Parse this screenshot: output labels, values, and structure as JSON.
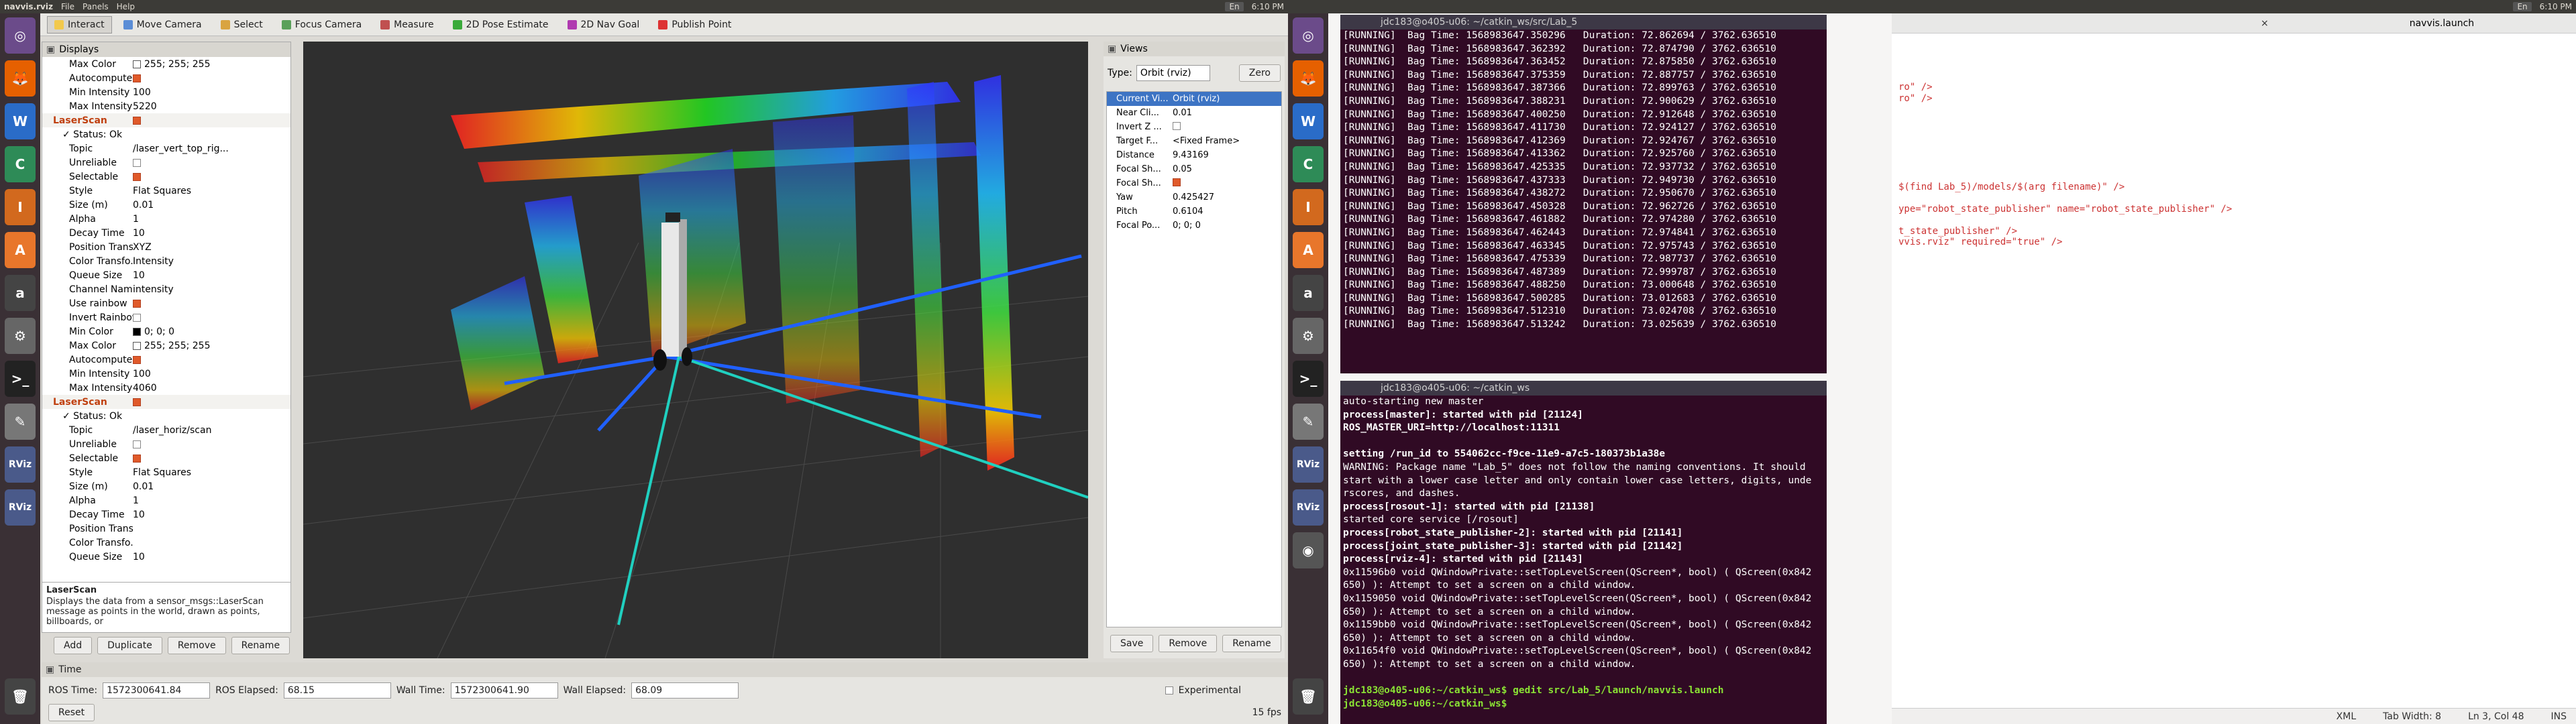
{
  "left": {
    "topbar": {
      "app": "navvis.rviz",
      "menus": [
        "File",
        "Panels",
        "Help"
      ],
      "keyboard": "En",
      "time": "6:10 PM"
    },
    "toolbar": [
      {
        "label": "Interact",
        "color": "#f2c94c"
      },
      {
        "label": "Move Camera",
        "color": "#5b8dd6"
      },
      {
        "label": "Select",
        "color": "#d9a441"
      },
      {
        "label": "Focus Camera",
        "color": "#5aa05a"
      },
      {
        "label": "Measure",
        "color": "#c05050"
      },
      {
        "label": "2D Pose Estimate",
        "color": "#3aaa3a"
      },
      {
        "label": "2D Nav Goal",
        "color": "#b03ab0"
      },
      {
        "label": "Publish Point",
        "color": "#d33"
      }
    ],
    "displays": {
      "title": "Displays",
      "rows": [
        {
          "n": "Max Color",
          "v": "255; 255; 255",
          "sw": "#ffffff"
        },
        {
          "n": "Autocompute ...",
          "cb": true
        },
        {
          "n": "Min Intensity",
          "v": "100"
        },
        {
          "n": "Max Intensity",
          "v": "5220"
        },
        {
          "n": "LaserScan",
          "cb": true,
          "head": true
        },
        {
          "n": "✓ Status: Ok",
          "sub": true
        },
        {
          "n": "Topic",
          "v": "/laser_vert_top_rig..."
        },
        {
          "n": "Unreliable",
          "cb": false
        },
        {
          "n": "Selectable",
          "cb": true
        },
        {
          "n": "Style",
          "v": "Flat Squares"
        },
        {
          "n": "Size (m)",
          "v": "0.01"
        },
        {
          "n": "Alpha",
          "v": "1"
        },
        {
          "n": "Decay Time",
          "v": "10"
        },
        {
          "n": "Position Trans...",
          "v": "XYZ"
        },
        {
          "n": "Color Transfo...",
          "v": "Intensity"
        },
        {
          "n": "Queue Size",
          "v": "10"
        },
        {
          "n": "Channel Name",
          "v": "intensity"
        },
        {
          "n": "Use rainbow",
          "cb": true
        },
        {
          "n": "Invert Rainbow",
          "cb": false
        },
        {
          "n": "Min Color",
          "v": "0; 0; 0",
          "sw": "#000000"
        },
        {
          "n": "Max Color",
          "v": "255; 255; 255",
          "sw": "#ffffff"
        },
        {
          "n": "Autocompute ...",
          "cb": true
        },
        {
          "n": "Min Intensity",
          "v": "100"
        },
        {
          "n": "Max Intensity",
          "v": "4060"
        },
        {
          "n": "LaserScan",
          "cb": true,
          "head": true
        },
        {
          "n": "✓ Status: Ok",
          "sub": true
        },
        {
          "n": "Topic",
          "v": "/laser_horiz/scan"
        },
        {
          "n": "Unreliable",
          "cb": false
        },
        {
          "n": "Selectable",
          "cb": true
        },
        {
          "n": "Style",
          "v": "Flat Squares"
        },
        {
          "n": "Size (m)",
          "v": "0.01"
        },
        {
          "n": "Alpha",
          "v": "1"
        },
        {
          "n": "Decay Time",
          "v": "10"
        },
        {
          "n": "Position Trans...",
          "v": ""
        },
        {
          "n": "Color Transfo...",
          "v": ""
        },
        {
          "n": "Queue Size",
          "v": "10"
        }
      ]
    },
    "help": {
      "title": "LaserScan",
      "text": "Displays the data from a sensor_msgs::LaserScan message as points in the world, drawn as points, billboards, or"
    },
    "display_buttons": [
      "Add",
      "Duplicate",
      "Remove",
      "Rename"
    ],
    "views": {
      "title": "Views",
      "type_label": "Type:",
      "type_value": "Orbit (rviz)",
      "zero": "Zero",
      "current": {
        "n": "Current Vi...",
        "v": "Orbit (rviz)"
      },
      "rows": [
        {
          "n": "Near Cli...",
          "v": "0.01"
        },
        {
          "n": "Invert Z ...",
          "cb": false
        },
        {
          "n": "Target F...",
          "v": "<Fixed Frame>"
        },
        {
          "n": "Distance",
          "v": "9.43169"
        },
        {
          "n": "Focal Sh...",
          "v": "0.05"
        },
        {
          "n": "Focal Sh...",
          "cb": true
        },
        {
          "n": "Yaw",
          "v": "0.425427"
        },
        {
          "n": "Pitch",
          "v": "0.6104"
        },
        {
          "n": "Focal Po...",
          "v": "0; 0; 0"
        }
      ],
      "buttons": [
        "Save",
        "Remove",
        "Rename"
      ]
    },
    "time": {
      "title": "Time",
      "ros_time_label": "ROS Time:",
      "ros_time": "1572300641.84",
      "ros_elapsed_label": "ROS Elapsed:",
      "ros_elapsed": "68.15",
      "wall_time_label": "Wall Time:",
      "wall_time": "1572300641.90",
      "wall_elapsed_label": "Wall Elapsed:",
      "wall_elapsed": "68.09",
      "experimental": "Experimental",
      "reset": "Reset",
      "fps": "15 fps"
    }
  },
  "right": {
    "topbar": {
      "keyboard": "En",
      "time": "6:10 PM"
    },
    "term1": {
      "title": "jdc183@o405-u06: ~/catkin_ws/src/Lab_5",
      "lines": [
        "[RUNNING]  Bag Time: 1568983647.350296   Duration: 72.862694 / 3762.636510",
        "[RUNNING]  Bag Time: 1568983647.362392   Duration: 72.874790 / 3762.636510",
        "[RUNNING]  Bag Time: 1568983647.363452   Duration: 72.875850 / 3762.636510",
        "[RUNNING]  Bag Time: 1568983647.375359   Duration: 72.887757 / 3762.636510",
        "[RUNNING]  Bag Time: 1568983647.387366   Duration: 72.899763 / 3762.636510",
        "[RUNNING]  Bag Time: 1568983647.388231   Duration: 72.900629 / 3762.636510",
        "[RUNNING]  Bag Time: 1568983647.400250   Duration: 72.912648 / 3762.636510",
        "[RUNNING]  Bag Time: 1568983647.411730   Duration: 72.924127 / 3762.636510",
        "[RUNNING]  Bag Time: 1568983647.412369   Duration: 72.924767 / 3762.636510",
        "[RUNNING]  Bag Time: 1568983647.413362   Duration: 72.925760 / 3762.636510",
        "[RUNNING]  Bag Time: 1568983647.425335   Duration: 72.937732 / 3762.636510",
        "[RUNNING]  Bag Time: 1568983647.437333   Duration: 72.949730 / 3762.636510",
        "[RUNNING]  Bag Time: 1568983647.438272   Duration: 72.950670 / 3762.636510",
        "[RUNNING]  Bag Time: 1568983647.450328   Duration: 72.962726 / 3762.636510",
        "[RUNNING]  Bag Time: 1568983647.461882   Duration: 72.974280 / 3762.636510",
        "[RUNNING]  Bag Time: 1568983647.462443   Duration: 72.974841 / 3762.636510",
        "[RUNNING]  Bag Time: 1568983647.463345   Duration: 72.975743 / 3762.636510",
        "[RUNNING]  Bag Time: 1568983647.475339   Duration: 72.987737 / 3762.636510",
        "[RUNNING]  Bag Time: 1568983647.487389   Duration: 72.999787 / 3762.636510",
        "[RUNNING]  Bag Time: 1568983647.488250   Duration: 73.000648 / 3762.636510",
        "[RUNNING]  Bag Time: 1568983647.500285   Duration: 73.012683 / 3762.636510",
        "[RUNNING]  Bag Time: 1568983647.512310   Duration: 73.024708 / 3762.636510",
        "[RUNNING]  Bag Time: 1568983647.513242   Duration: 73.025639 / 3762.636510"
      ]
    },
    "term2": {
      "title": "jdc183@o405-u06: ~/catkin_ws",
      "lines": [
        "auto-starting new master",
        "process[master]: started with pid [21124]",
        "ROS_MASTER_URI=http://localhost:11311",
        "",
        "setting /run_id to 554062cc-f9ce-11e9-a7c5-180373b1a38e",
        "WARNING: Package name \"Lab_5\" does not follow the naming conventions. It should",
        "start with a lower case letter and only contain lower case letters, digits, unde",
        "rscores, and dashes.",
        "process[rosout-1]: started with pid [21138]",
        "started core service [/rosout]",
        "process[robot_state_publisher-2]: started with pid [21141]",
        "process[joint_state_publisher-3]: started with pid [21142]",
        "process[rviz-4]: started with pid [21143]",
        "0x11596b0 void QWindowPrivate::setTopLevelScreen(QScreen*, bool) ( QScreen(0x842",
        "650) ): Attempt to set a screen on a child window.",
        "0x1159050 void QWindowPrivate::setTopLevelScreen(QScreen*, bool) ( QScreen(0x842",
        "650) ): Attempt to set a screen on a child window.",
        "0x1159bb0 void QWindowPrivate::setTopLevelScreen(QScreen*, bool) ( QScreen(0x842",
        "650) ): Attempt to set a screen on a child window.",
        "0x11654f0 void QWindowPrivate::setTopLevelScreen(QScreen*, bool) ( QScreen(0x842",
        "650) ): Attempt to set a screen on a child window.",
        "",
        "jdc183@o405-u06:~/catkin_ws$ gedit src/Lab_5/launch/navvis.launch",
        "jdc183@o405-u06:~/catkin_ws$ "
      ]
    },
    "gedit": {
      "tab": "navvis.launch",
      "lines": [
        "",
        "",
        "",
        "",
        "ro\" />",
        "ro\" />",
        "",
        "",
        "",
        "",
        "",
        "",
        "",
        "$(find Lab_5)/models/$(arg filename)\" />",
        "",
        "ype=\"robot_state_publisher\" name=\"robot_state_publisher\" />",
        "",
        "t_state_publisher\" />",
        "vvis.rviz\" required=\"true\" />"
      ],
      "status": {
        "lang": "XML",
        "tab": "Tab Width: 8",
        "pos": "Ln 3, Col 48",
        "mode": "INS"
      }
    }
  }
}
